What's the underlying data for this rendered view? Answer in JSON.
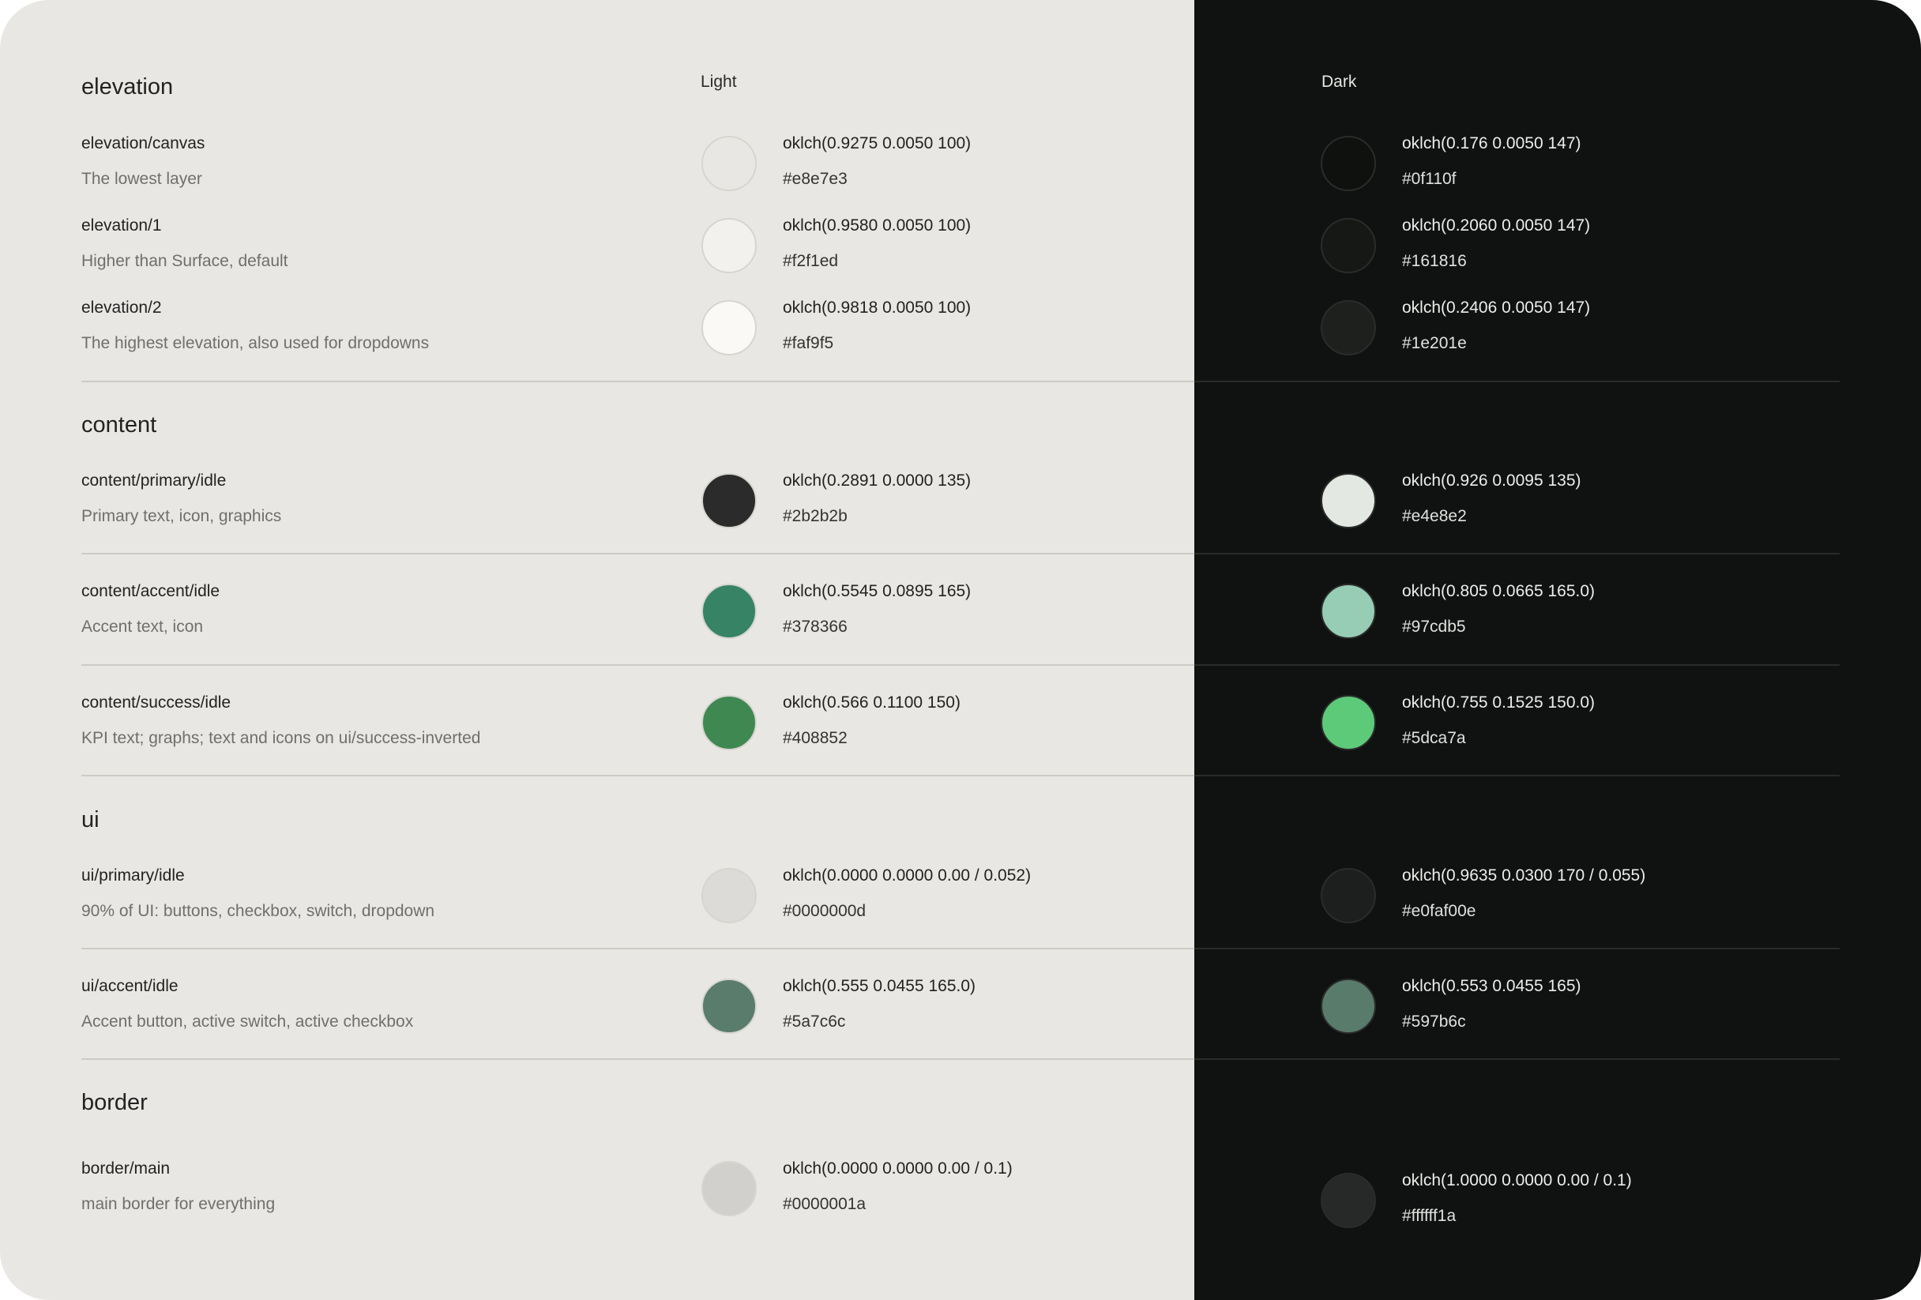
{
  "columns": {
    "light": "Light",
    "dark": "Dark"
  },
  "sections": {
    "elevation": "elevation",
    "content": "content",
    "ui": "ui",
    "border": "border"
  },
  "tokens": [
    {
      "name": "elevation/canvas",
      "description": "The lowest layer",
      "light": {
        "oklch": "oklch(0.9275 0.0050 100)",
        "hex": "#e8e7e3",
        "color": "#e8e7e3"
      },
      "dark": {
        "oklch": "oklch(0.176 0.0050 147)",
        "hex": "#0f110f",
        "color": "#0f110f"
      }
    },
    {
      "name": "elevation/1",
      "description": "Higher than Surface, default",
      "light": {
        "oklch": "oklch(0.9580 0.0050 100)",
        "hex": "#f2f1ed",
        "color": "#f2f1ed"
      },
      "dark": {
        "oklch": "oklch(0.2060 0.0050 147)",
        "hex": "#161816",
        "color": "#161816"
      }
    },
    {
      "name": "elevation/2",
      "description": "The highest elevation, also used for dropdowns",
      "light": {
        "oklch": "oklch(0.9818 0.0050 100)",
        "hex": "#faf9f5",
        "color": "#faf9f5"
      },
      "dark": {
        "oklch": "oklch(0.2406 0.0050 147)",
        "hex": "#1e201e",
        "color": "#1e201e"
      }
    },
    {
      "name": "content/primary/idle",
      "description": "Primary text, icon, graphics",
      "light": {
        "oklch": "oklch(0.2891 0.0000 135)",
        "hex": "#2b2b2b",
        "color": "#2b2b2b"
      },
      "dark": {
        "oklch": "oklch(0.926 0.0095 135)",
        "hex": "#e4e8e2",
        "color": "#e4e8e2"
      }
    },
    {
      "name": "content/accent/idle",
      "description": "Accent text, icon",
      "light": {
        "oklch": "oklch(0.5545 0.0895 165)",
        "hex": "#378366",
        "color": "#378366"
      },
      "dark": {
        "oklch": "oklch(0.805 0.0665 165.0)",
        "hex": "#97cdb5",
        "color": "#97cdb5"
      }
    },
    {
      "name": "content/success/idle",
      "description": "KPI text; graphs; text and icons on ui/success-inverted",
      "light": {
        "oklch": "oklch(0.566 0.1100 150)",
        "hex": "#408852",
        "color": "#408852"
      },
      "dark": {
        "oklch": "oklch(0.755 0.1525 150.0)",
        "hex": "#5dca7a",
        "color": "#5dca7a"
      }
    },
    {
      "name": "ui/primary/idle",
      "description": "90% of UI: buttons, checkbox, switch, dropdown",
      "light": {
        "oklch": "oklch(0.0000 0.0000 0.00 / 0.052)",
        "hex": "#0000000d",
        "color": "#dcdbd7"
      },
      "dark": {
        "oklch": "oklch(0.9635 0.0300 170 / 0.055)",
        "hex": "#e0faf00e",
        "color": "#1c1f1e"
      }
    },
    {
      "name": "ui/accent/idle",
      "description": "Accent button, active switch, active checkbox",
      "light": {
        "oklch": "oklch(0.555 0.0455 165.0)",
        "hex": "#5a7c6c",
        "color": "#5a7c6c"
      },
      "dark": {
        "oklch": "oklch(0.553 0.0455 165)",
        "hex": "#597b6c",
        "color": "#597b6c"
      }
    },
    {
      "name": "border/main",
      "description": "main border for everything",
      "light": {
        "oklch": "oklch(0.0000 0.0000 0.00 / 0.1)",
        "hex": "#0000001a",
        "color": "#d1d0cc"
      },
      "dark": {
        "oklch": "oklch(1.0000 0.0000 0.00 / 0.1)",
        "hex": "#ffffff1a",
        "color": "#272828"
      }
    }
  ]
}
